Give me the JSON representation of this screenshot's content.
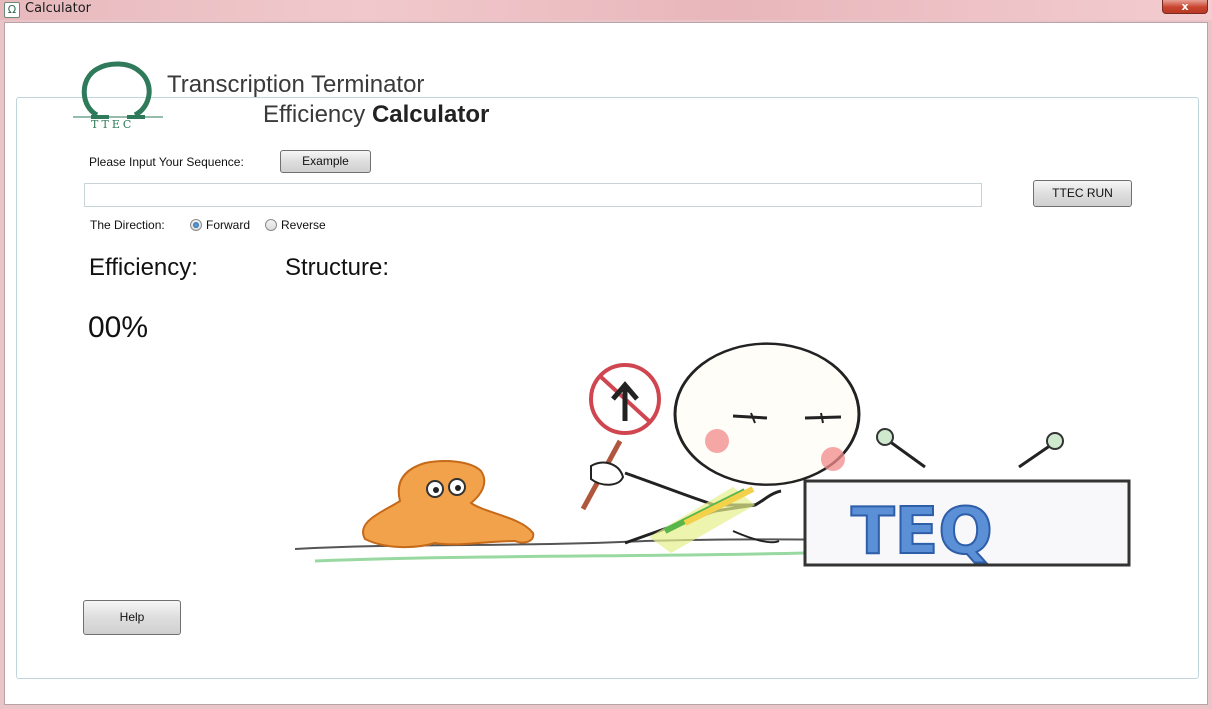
{
  "window": {
    "title": "Calculator",
    "close_label": "x"
  },
  "header": {
    "logo_text": "TTEC",
    "line1": "Transcription Terminator",
    "line2_prefix": "Efficiency",
    "line2_bold": "Calculator"
  },
  "sequence": {
    "prompt": "Please Input Your Sequence:",
    "example_label": "Example",
    "value": "",
    "placeholder": ""
  },
  "run_button_label": "TTEC RUN",
  "direction": {
    "label": "The Direction:",
    "options": [
      "Forward",
      "Reverse"
    ],
    "selected": "Forward"
  },
  "results": {
    "efficiency_label": "Efficiency:",
    "structure_label": "Structure:",
    "efficiency_value": "00%"
  },
  "illustration": {
    "sign_text": "TEQ"
  },
  "help_label": "Help",
  "colors": {
    "accent_green": "#2e7a5a",
    "panel_border": "#bfd6dc",
    "radio_fill": "#1f5fa0"
  }
}
